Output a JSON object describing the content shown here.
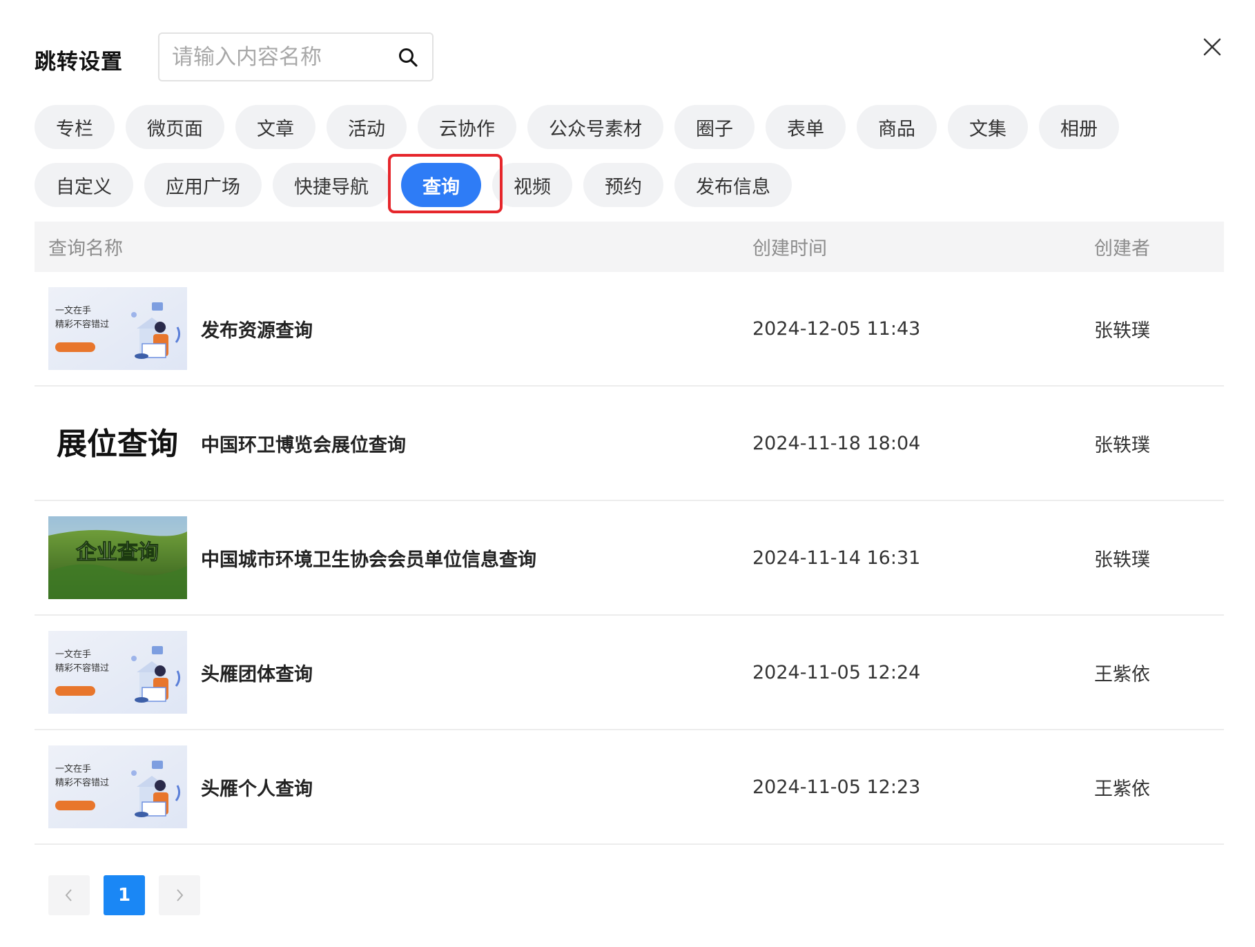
{
  "header": {
    "title": "跳转设置",
    "search_placeholder": "请输入内容名称"
  },
  "tabs": {
    "row1": [
      "专栏",
      "微页面",
      "文章",
      "活动",
      "云协作",
      "公众号素材",
      "圈子",
      "表单",
      "商品",
      "文集",
      "相册"
    ],
    "row2": [
      "自定义",
      "应用广场",
      "快捷导航",
      "查询",
      "视频",
      "预约",
      "发布信息"
    ],
    "active": "查询"
  },
  "table": {
    "columns": {
      "name": "查询名称",
      "time": "创建时间",
      "creator": "创建者"
    },
    "rows": [
      {
        "thumb": "banner",
        "thumb_text": [
          "一文在手",
          "精彩不容错过"
        ],
        "name": "发布资源查询",
        "time": "2024-12-05 11:43",
        "creator": "张轶璞"
      },
      {
        "thumb": "text",
        "thumb_text": [
          "展位查询"
        ],
        "name": "中国环卫博览会展位查询",
        "time": "2024-11-18 18:04",
        "creator": "张轶璞"
      },
      {
        "thumb": "landscape",
        "thumb_text": [
          "企业查询"
        ],
        "name": "中国城市环境卫生协会会员单位信息查询",
        "time": "2024-11-14 16:31",
        "creator": "张轶璞"
      },
      {
        "thumb": "banner",
        "thumb_text": [
          "一文在手",
          "精彩不容错过"
        ],
        "name": "头雁团体查询",
        "time": "2024-11-05 12:24",
        "creator": "王紫依"
      },
      {
        "thumb": "banner",
        "thumb_text": [
          "一文在手",
          "精彩不容错过"
        ],
        "name": "头雁个人查询",
        "time": "2024-11-05 12:23",
        "creator": "王紫依"
      }
    ]
  },
  "pagination": {
    "current_page": "1",
    "prev_icon": "chevron-left-icon",
    "next_icon": "chevron-right-icon"
  },
  "colors": {
    "accent": "#2e7cf6",
    "highlight_border": "#e6262b",
    "tab_bg": "#f1f2f4",
    "header_bg": "#f4f4f5"
  }
}
